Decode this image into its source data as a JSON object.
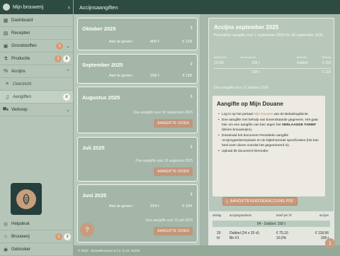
{
  "app": {
    "name": "Mijn brouwerij",
    "page_title": "Accijnsaangiften"
  },
  "sidebar": {
    "items": [
      {
        "label": "Dashboard",
        "icon": "dashboard-icon"
      },
      {
        "label": "Recepten",
        "icon": "book-icon"
      },
      {
        "label": "Grondstoffen",
        "icon": "box-icon",
        "badge": "1"
      },
      {
        "label": "Productie",
        "icon": "flask-icon",
        "badge": "8"
      },
      {
        "label": "Accijns",
        "icon": "percent-icon"
      },
      {
        "label": "Overzicht",
        "icon": "list-icon"
      },
      {
        "label": "Aangiften",
        "icon": "document-icon",
        "badge": "6"
      },
      {
        "label": "Verkoop",
        "icon": "cart-icon"
      }
    ],
    "bottom_items": [
      {
        "label": "Helpdesk",
        "icon": "help-icon"
      },
      {
        "label": "Brouwerij",
        "icon": "building-icon",
        "badge_orange": "1",
        "badge_white": "3"
      },
      {
        "label": "Gebruiker",
        "icon": "user-icon"
      }
    ]
  },
  "months": [
    {
      "title": "Oktober 2025",
      "label": "Aan te geven :",
      "qty": "400 ℓ",
      "amount": "€ 129"
    },
    {
      "title": "September 2025",
      "label": "Aan te geven :",
      "qty": "158 ℓ",
      "amount": "€ 118"
    },
    {
      "title": "Augustus 2025",
      "note": "Doe aangifte voor 30 september 2025",
      "button": "AANGIFTE DOEN"
    },
    {
      "title": "Juli 2025",
      "note": "Doe aangifte voor 31 augustus 2025",
      "button": "AANGIFTE DOEN"
    },
    {
      "title": "Juni 2025",
      "label": "Aan te geven :",
      "qty": "234 ℓ",
      "amount": "€ 104",
      "note": "Doe aangifte voor 31 juli 2025",
      "button": "AANGIFTE DOEN"
    }
  ],
  "detail": {
    "title": "Accijns september 2025",
    "intro": "Periodieke aangifte voor 1 september 2025 t/m 30 september 2025",
    "table_headers": [
      "tariefcode",
      "bronvolume",
      "",
      "tarieven",
      "bedrag"
    ],
    "rows": [
      {
        "code": "10.0%",
        "volume": "158 ℓ",
        "tariff": "Dubbel",
        "amount": "€ 118"
      },
      {
        "code": "",
        "volume": "158 ℓ",
        "tariff": "",
        "amount": "€ 118"
      }
    ],
    "deadline": "Doe aangifte voor 31 oktober 2025"
  },
  "douane": {
    "title": "Aangifte op Mijn Douane",
    "steps": [
      {
        "pre": "Log in op het portaal ",
        "link": "Mijn Douane",
        "post": " van de Belastingdienst."
      },
      {
        "text": "Doe aangifte met behulp van bovenstaande gegevens. Het gaat hier om een aangifte van bier tegen het ",
        "strong": "VERLAAGDE TARIEF",
        "post": " (kleine brouwerijen)."
      },
      {
        "pre": "Download het document ",
        "em": "Periodieke aangifte Accijnsgoederenplaats",
        "post": " en de bijbehorende specificaties (het kan heel even duren voordat het gegenereerd is)."
      },
      {
        "text": "Upload dit document hieronder."
      }
    ],
    "button": "AANGIFTEVERZOEKACCIJNS.PDF"
  },
  "lines": {
    "headers": [
      "uitslag",
      "accijnsgoederen",
      "tarief per hl",
      "accijns"
    ],
    "band": "84 - Dubbel: 158 ℓ",
    "row": {
      "count": "20",
      "unit": "hl",
      "product": "Dubbel (24 x 33 cl)",
      "tariff": "Bk-V1",
      "price": "€ 75,10",
      "pct": "10,0%",
      "total": "€ 118,96",
      "liters": "158 ℓ"
    }
  },
  "footer": {
    "text": "© 2025 - BrouwBrouwen & Co. b.v.b. 15420"
  },
  "help_button": "?",
  "float_badge": "1"
}
